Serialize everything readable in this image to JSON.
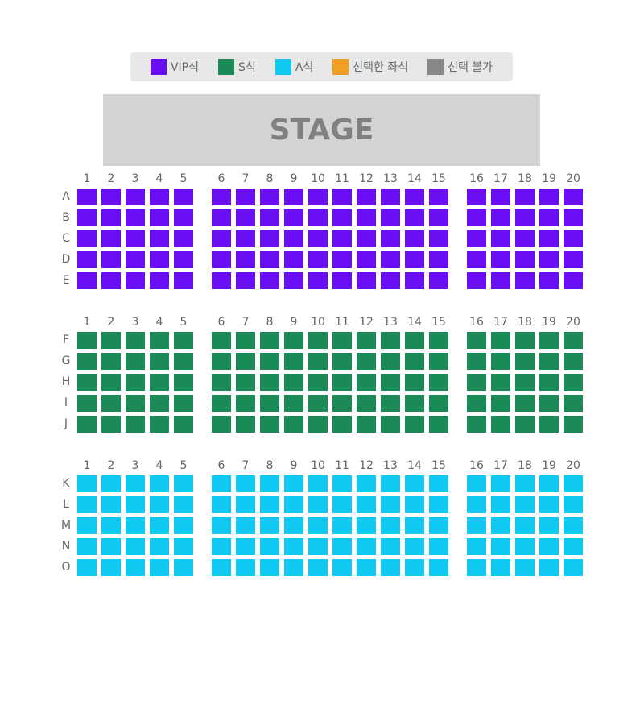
{
  "legend": [
    {
      "label": "VIP석",
      "color": "#6a0ef5",
      "key": "vip"
    },
    {
      "label": "S석",
      "color": "#1a8a56",
      "key": "s"
    },
    {
      "label": "A석",
      "color": "#0fc9f2",
      "key": "a"
    },
    {
      "label": "선택한 좌석",
      "color": "#f0a020",
      "key": "selected"
    },
    {
      "label": "선택 불가",
      "color": "#888888",
      "key": "unavailable"
    }
  ],
  "stage": {
    "label": "STAGE"
  },
  "columns": [
    "1",
    "2",
    "3",
    "4",
    "5",
    "6",
    "7",
    "8",
    "9",
    "10",
    "11",
    "12",
    "13",
    "14",
    "15",
    "16",
    "17",
    "18",
    "19",
    "20"
  ],
  "sections": [
    {
      "name": "VIP석",
      "color": "#6a0ef5",
      "rows": [
        "A",
        "B",
        "C",
        "D",
        "E"
      ]
    },
    {
      "name": "S석",
      "color": "#1a8a56",
      "rows": [
        "F",
        "G",
        "H",
        "I",
        "J"
      ]
    },
    {
      "name": "A석",
      "color": "#0fc9f2",
      "rows": [
        "K",
        "L",
        "M",
        "N",
        "O"
      ]
    }
  ]
}
